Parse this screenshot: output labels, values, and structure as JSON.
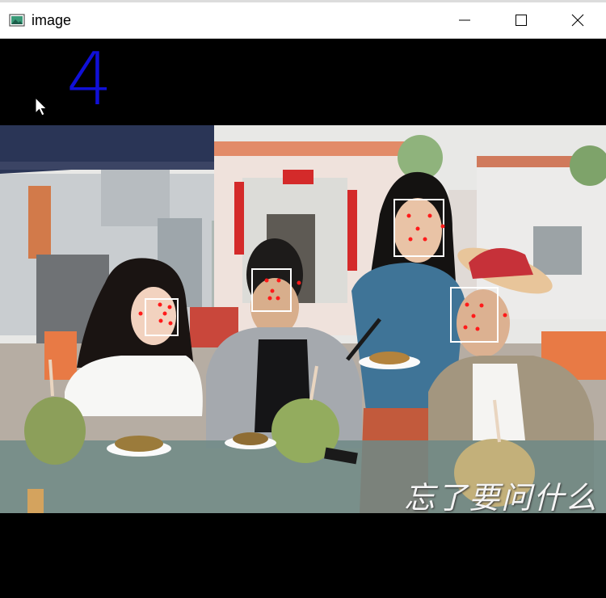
{
  "window": {
    "title": "image",
    "icon": "image-app-icon",
    "controls": [
      "minimize-icon",
      "maximize-icon",
      "close-icon"
    ]
  },
  "overlay": {
    "counter": "4",
    "counter_color": "#1010d8",
    "box_color": "#ffffff",
    "landmark_color": "#ff1a1a"
  },
  "video": {
    "subtitle": "忘了要问什么"
  }
}
